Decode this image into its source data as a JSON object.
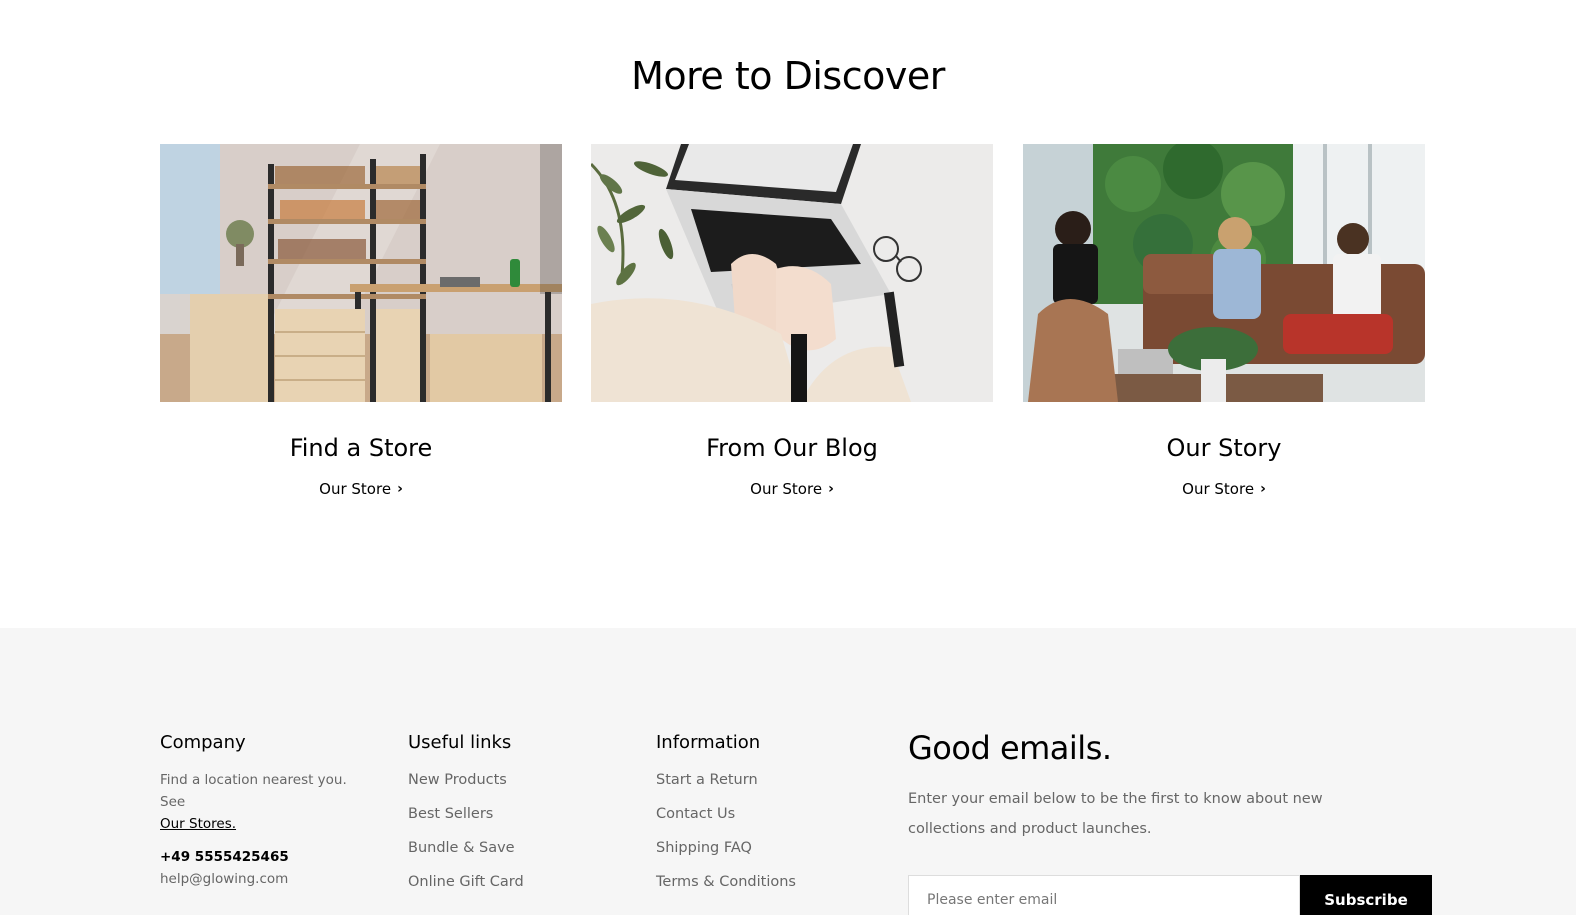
{
  "discover": {
    "title": "More to Discover",
    "cards": [
      {
        "title": "Find a Store",
        "link": "Our Store",
        "image": "store-shelves-photo"
      },
      {
        "title": "From Our Blog",
        "link": "Our Store",
        "image": "laptop-typing-photo"
      },
      {
        "title": "Our Story",
        "link": "Our Store",
        "image": "team-meeting-photo"
      }
    ]
  },
  "footer": {
    "company": {
      "heading": "Company",
      "text": "Find a location nearest you. See",
      "link": "Our Stores.",
      "phone": "+49 5555425465",
      "email": "help@glowing.com"
    },
    "useful_links": {
      "heading": "Useful links",
      "items": [
        "New Products",
        "Best Sellers",
        "Bundle & Save",
        "Online Gift Card"
      ]
    },
    "information": {
      "heading": "Information",
      "items": [
        "Start a Return",
        "Contact Us",
        "Shipping FAQ",
        "Terms & Conditions"
      ]
    },
    "newsletter": {
      "title": "Good emails.",
      "description": "Enter your email below to be the first to know about new collections and product launches.",
      "placeholder": "Please enter email",
      "button": "Subscribe"
    }
  },
  "colors": {
    "background": "#ffffff",
    "footer_background": "#f6f6f6",
    "button": "#000000",
    "muted_text": "#666666"
  }
}
